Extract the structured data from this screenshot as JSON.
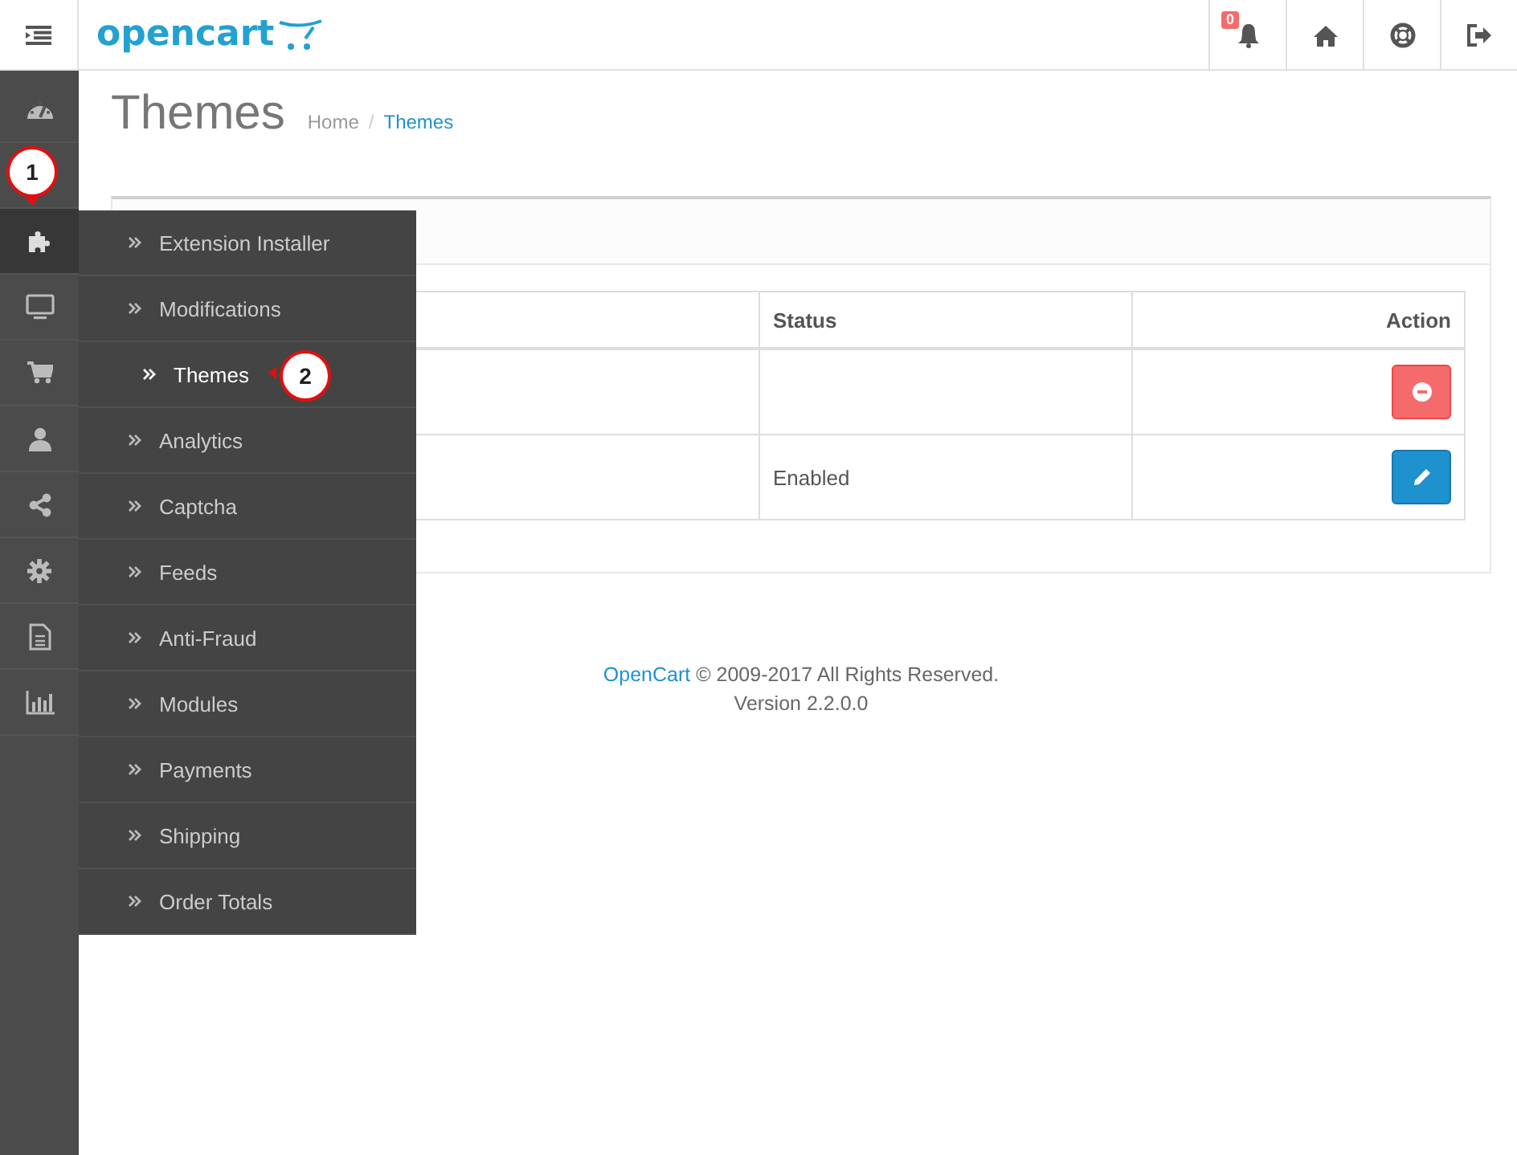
{
  "header": {
    "logo": "opencart",
    "notification_count": "0"
  },
  "sidebar": {
    "items": [
      {
        "selected": false
      },
      {
        "selected": false
      },
      {
        "selected": true
      },
      {
        "selected": false
      },
      {
        "selected": false
      },
      {
        "selected": false
      },
      {
        "selected": false
      },
      {
        "selected": false
      },
      {
        "selected": false
      },
      {
        "selected": false
      }
    ]
  },
  "menu": {
    "items": [
      {
        "label": "Extension Installer",
        "selected": false
      },
      {
        "label": "Modifications",
        "selected": false
      },
      {
        "label": "Themes",
        "selected": true
      },
      {
        "label": "Analytics",
        "selected": false
      },
      {
        "label": "Captcha",
        "selected": false
      },
      {
        "label": "Feeds",
        "selected": false
      },
      {
        "label": "Anti-Fraud",
        "selected": false
      },
      {
        "label": "Modules",
        "selected": false
      },
      {
        "label": "Payments",
        "selected": false
      },
      {
        "label": "Shipping",
        "selected": false
      },
      {
        "label": "Order Totals",
        "selected": false
      }
    ]
  },
  "page": {
    "title": "Themes",
    "breadcrumb_separator": "/",
    "breadcrumb": [
      {
        "label": "Home",
        "selected": false
      },
      {
        "label": "Themes",
        "selected": true
      }
    ]
  },
  "table": {
    "columns": [
      "Status",
      "Action"
    ],
    "rows": [
      {
        "kind": "uninstall"
      },
      {
        "status": "Enabled",
        "kind": "edit"
      }
    ]
  },
  "footer": {
    "link": "OpenCart",
    "text": "© 2009-2017 All Rights Reserved.",
    "version": "Version 2.2.0.0"
  },
  "callouts": [
    {
      "label": "1"
    },
    {
      "label": "2"
    }
  ]
}
